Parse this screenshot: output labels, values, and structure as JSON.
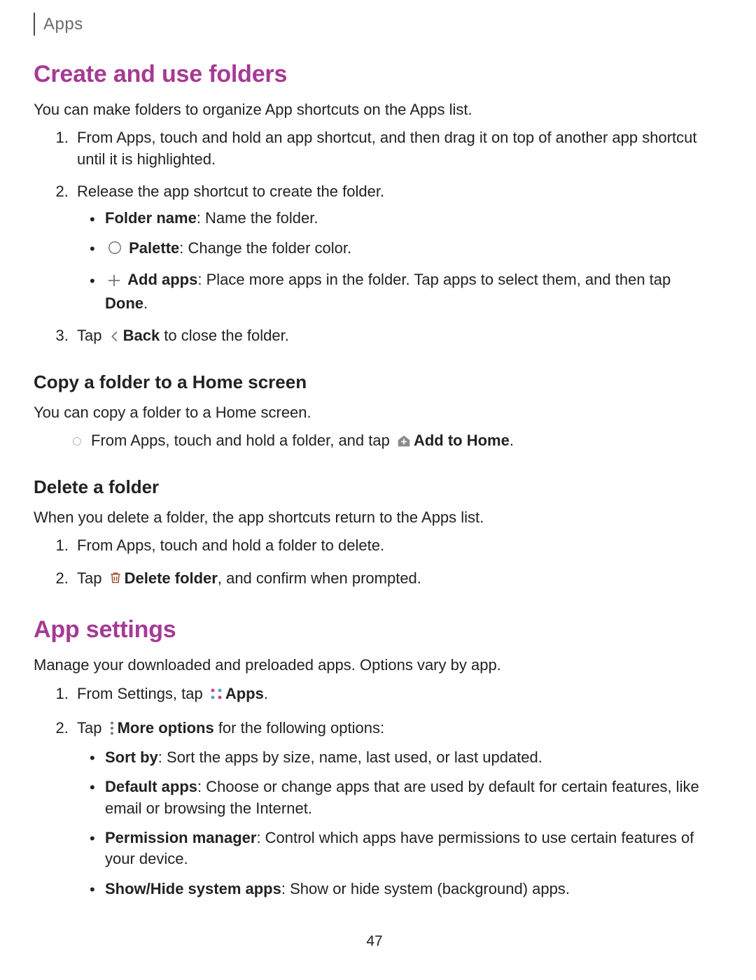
{
  "header": {
    "section": "Apps"
  },
  "h2_folders": "Create and use folders",
  "p_folders_intro": "You can make folders to organize App shortcuts on the Apps list.",
  "steps_folders": {
    "s1": "From Apps, touch and hold an app shortcut, and then drag it on top of another app shortcut until it is highlighted.",
    "s2": "Release the app shortcut to create the folder.",
    "s2_b1_bold": "Folder name",
    "s2_b1_rest": ": Name the folder.",
    "s2_b2_bold": "Palette",
    "s2_b2_rest": ": Change the folder color.",
    "s2_b3_bold": "Add apps",
    "s2_b3_rest_a": ": Place more apps in the folder. Tap apps to select them, and then tap ",
    "s2_b3_done": "Done",
    "s2_b3_period": ".",
    "s3_pre": "Tap ",
    "s3_back": "Back",
    "s3_post": " to close the folder."
  },
  "h3_copy": "Copy a folder to a Home screen",
  "p_copy": "You can copy a folder to a Home screen.",
  "copy_bullet_pre": "From Apps, touch and hold a folder, and tap ",
  "copy_bullet_bold": "Add to Home",
  "copy_bullet_period": ".",
  "h3_delete": "Delete a folder",
  "p_delete": "When you delete a folder, the app shortcuts return to the Apps list.",
  "steps_delete": {
    "s1": "From Apps, touch and hold a folder to delete.",
    "s2_pre": "Tap ",
    "s2_bold": "Delete folder",
    "s2_post": ", and confirm when prompted."
  },
  "h2_appsettings": "App settings",
  "p_appsettings": "Manage your downloaded and preloaded apps. Options vary by app.",
  "steps_appsettings": {
    "s1_pre": "From Settings, tap ",
    "s1_bold": "Apps",
    "s1_period": ".",
    "s2_pre": "Tap ",
    "s2_bold": "More options",
    "s2_post": " for the following options:",
    "b_sort_bold": "Sort by",
    "b_sort_rest": ": Sort the apps by size, name, last used, or last updated.",
    "b_default_bold": "Default apps",
    "b_default_rest": ": Choose or change apps that are used by default for certain features, like email or browsing the Internet.",
    "b_perm_bold": "Permission manager",
    "b_perm_rest": ": Control which apps have permissions to use certain features of your device.",
    "b_show_bold": "Show/Hide system apps",
    "b_show_rest": ": Show or hide system (background) apps."
  },
  "page_number": "47"
}
